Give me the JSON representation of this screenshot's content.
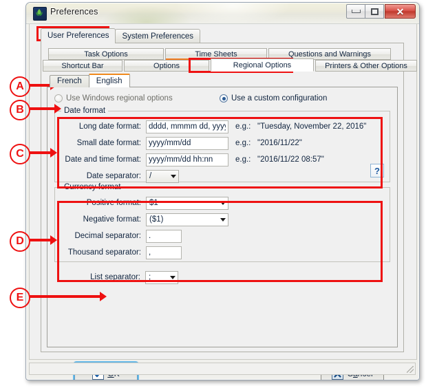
{
  "window": {
    "title": "Preferences",
    "icon": "app-leaf-icon",
    "controls": {
      "minimize": "–",
      "maximize": "□",
      "close": "✕"
    }
  },
  "top_tabs": [
    {
      "label": "User Preferences",
      "active": true
    },
    {
      "label": "System Preferences",
      "active": false
    }
  ],
  "category_tabs_row1": [
    {
      "label": "Task Options",
      "active": false
    },
    {
      "label": "Time Sheets",
      "active": false,
      "underline": true
    },
    {
      "label": "Questions and Warnings",
      "active": false
    }
  ],
  "category_tabs_row2": [
    {
      "label": "Shortcut Bar",
      "active": false
    },
    {
      "label": "Options",
      "active": false
    },
    {
      "label": "Regional Options",
      "active": true
    },
    {
      "label": "Printers & Other Options",
      "active": false
    }
  ],
  "language_tabs": [
    {
      "label": "French",
      "active": false
    },
    {
      "label": "English",
      "active": true
    }
  ],
  "radios": {
    "windows_regional": {
      "label": "Use Windows regional options",
      "selected": false
    },
    "custom_config": {
      "label": "Use a custom configuration",
      "selected": true
    }
  },
  "date_format": {
    "group_title": "Date format",
    "fields": [
      {
        "label": "Long date format:",
        "value": "dddd, mmmm dd, yyyy",
        "eg_label": "e.g.:",
        "eg_value": "\"Tuesday, November 22, 2016\""
      },
      {
        "label": "Small date format:",
        "value": "yyyy/mm/dd",
        "eg_label": "e.g.:",
        "eg_value": "\"2016/11/22\""
      },
      {
        "label": "Date and time format:",
        "value": "yyyy/mm/dd hh:nn",
        "eg_label": "e.g.:",
        "eg_value": "\"2016/11/22 08:57\""
      }
    ],
    "separator": {
      "label": "Date separator:",
      "value": "/"
    },
    "help_button": "?"
  },
  "currency_format": {
    "group_title": "Currency format",
    "positive": {
      "label": "Positive format:",
      "value": "$1"
    },
    "negative": {
      "label": "Negative format:",
      "value": "($1)"
    },
    "decimal": {
      "label": "Decimal separator:",
      "value": "."
    },
    "thousand": {
      "label": "Thousand separator:",
      "value": ","
    }
  },
  "list_separator": {
    "label": "List separator:",
    "value": ";"
  },
  "buttons": {
    "ok": {
      "label_pre": "",
      "label_accel": "O",
      "label_post": "K",
      "icon": "check-icon"
    },
    "cancel": {
      "label_pre": "C",
      "label_accel": "a",
      "label_post": "ncel",
      "icon": "x-icon"
    }
  },
  "annotation_markers": [
    {
      "letter": "A"
    },
    {
      "letter": "B"
    },
    {
      "letter": "C"
    },
    {
      "letter": "D"
    },
    {
      "letter": "E"
    }
  ],
  "colors": {
    "annotation_red": "#ee1111",
    "active_tab_accent": "#f08a1e",
    "focus_blue": "#66b9e8"
  }
}
